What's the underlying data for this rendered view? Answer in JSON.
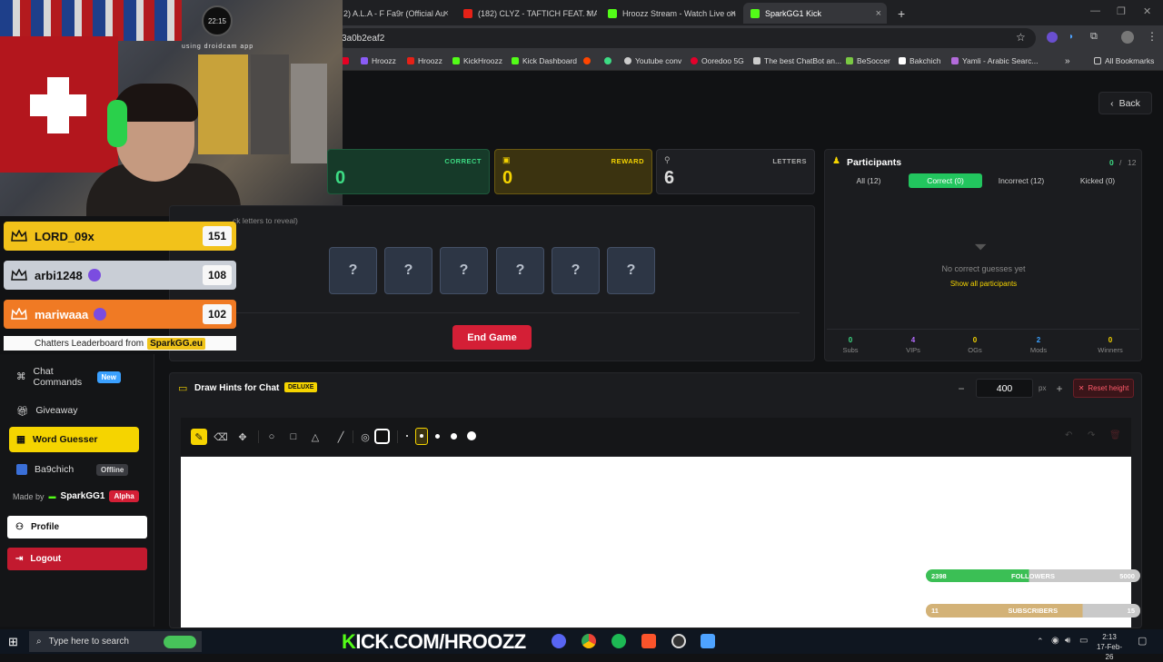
{
  "browser": {
    "tabs": [
      {
        "label": "2) A.L.A - F Fa9r (Official Au"
      },
      {
        "label": "(182) CLYZ - TAFTICH FEAT. MA"
      },
      {
        "label": "Hroozz Stream - Watch Live on"
      },
      {
        "label": "SparkGG1 Kick"
      }
    ],
    "url": "3a0b2eaf2",
    "bookmarks": [
      "Hroozz",
      "Hroozz",
      "KickHroozz",
      "Kick Dashboard",
      "Youtube conv",
      "Ooredoo 5G",
      "The best ChatBot an...",
      "BeSoccer",
      "Bakchich",
      "Yamli - Arabic Searc..."
    ],
    "all_bookmarks": "All Bookmarks"
  },
  "webcam": {
    "clock": "22:15",
    "overlay_text": "using droidcam app"
  },
  "leaderboard": {
    "entries": [
      {
        "name": "LORD_09x",
        "score": "151",
        "color": "#f2c21a"
      },
      {
        "name": "arbi1248",
        "score": "108",
        "color": "#c9ced6"
      },
      {
        "name": "mariwaaa",
        "score": "102",
        "color": "#f07a24"
      }
    ],
    "footer": "Chatters Leaderboard from",
    "footer_brand": "SparkGG.eu"
  },
  "sidebar": {
    "items": [
      {
        "label": "Chat Commands",
        "badge": "New"
      },
      {
        "label": "Giveaway"
      },
      {
        "label": "Word Guesser"
      },
      {
        "label": "Ba9chich",
        "badge": "Offline"
      }
    ],
    "made_by": "Made by",
    "brand": "SparkGG1",
    "alpha": "Alpha",
    "profile": "Profile",
    "logout": "Logout"
  },
  "header": {
    "back": "Back"
  },
  "cards": {
    "correct": {
      "label": "CORRECT",
      "value": "0"
    },
    "reward": {
      "label": "REWARD",
      "value": "0"
    },
    "letters": {
      "label": "LETTERS",
      "value": "6"
    }
  },
  "word": {
    "hint": "ck letters to reveal)",
    "letters": [
      "?",
      "?",
      "?",
      "?",
      "?",
      "?"
    ],
    "end_button": "End Game"
  },
  "participants": {
    "title": "Participants",
    "count": "0",
    "total": "12",
    "tabs": [
      {
        "label": "All (12)"
      },
      {
        "label": "Correct (0)"
      },
      {
        "label": "Incorrect (12)"
      },
      {
        "label": "Kicked (0)"
      }
    ],
    "empty": "No correct guesses yet",
    "show_all": "Show all participants",
    "stats": [
      {
        "value": "0",
        "label": "Subs",
        "color": "#3ddc84"
      },
      {
        "value": "4",
        "label": "VIPs",
        "color": "#b66dff"
      },
      {
        "value": "0",
        "label": "OGs",
        "color": "#f5d400"
      },
      {
        "value": "2",
        "label": "Mods",
        "color": "#3aa0ff"
      },
      {
        "value": "0",
        "label": "Winners",
        "color": "#f5d400"
      }
    ]
  },
  "draw": {
    "title": "Draw Hints for Chat",
    "badge": "DELUXE",
    "height": "400",
    "unit": "px",
    "reset": "Reset height"
  },
  "goals": {
    "followers": {
      "current": "2398",
      "label": "FOLLOWERS",
      "target": "5000",
      "progress": 0.48
    },
    "subscribers": {
      "current": "11",
      "label": "SUBSCRIBERS",
      "target": "15",
      "progress": 0.73
    }
  },
  "taskbar": {
    "search_placeholder": "Type here to search",
    "kick_prefix": "K",
    "kick_text": "ICK.COM/HROOZZ",
    "time": "2:13",
    "date": "17-Feb-26"
  }
}
